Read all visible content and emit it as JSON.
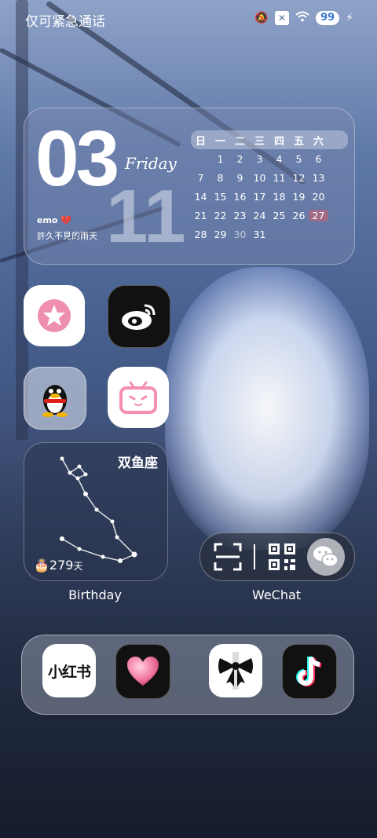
{
  "status_bar": {
    "carrier": "仅可紧急通话",
    "battery": "99",
    "icons": [
      "mute-icon",
      "no-sim-icon",
      "wifi-icon",
      "battery-icon",
      "charging-icon"
    ]
  },
  "date_widget": {
    "day": "03",
    "weekday": "Friday",
    "month": "11",
    "mood": "emo 💔",
    "phrase": "許久不見的雨天",
    "calendar": {
      "headers": [
        "日",
        "一",
        "二",
        "三",
        "四",
        "五",
        "六"
      ],
      "weeks": [
        [
          "",
          "1",
          "2",
          "3",
          "4",
          "5",
          "6"
        ],
        [
          "7",
          "8",
          "9",
          "10",
          "11",
          "12",
          "13"
        ],
        [
          "14",
          "15",
          "16",
          "17",
          "18",
          "19",
          "20"
        ],
        [
          "21",
          "22",
          "23",
          "24",
          "25",
          "26",
          "27"
        ],
        [
          "28",
          "29",
          "30",
          "31",
          "",
          "",
          ""
        ]
      ],
      "today": "27",
      "dimmed": [
        "30"
      ]
    }
  },
  "apps": {
    "row1": [
      {
        "name": "star-app",
        "icon": "pink-star-icon"
      },
      {
        "name": "weibo",
        "icon": "weibo-icon"
      }
    ],
    "row2": [
      {
        "name": "qq",
        "icon": "qq-penguin-icon"
      },
      {
        "name": "bilibili",
        "icon": "bilibili-tv-icon"
      }
    ]
  },
  "constellation_widget": {
    "sign": "双鱼座",
    "days": "279",
    "unit": "天",
    "label": "Birthday"
  },
  "wechat_widget": {
    "label": "WeChat",
    "icons": [
      "scan-icon",
      "qr-code-icon",
      "wechat-icon"
    ]
  },
  "dock": {
    "apps": [
      {
        "name": "xiaohongshu",
        "text": "小红书"
      },
      {
        "name": "heart-app",
        "icon": "heart-icon"
      },
      {
        "name": "bow-app",
        "icon": "bow-icon"
      },
      {
        "name": "tiktok",
        "icon": "tiktok-note-icon"
      }
    ]
  },
  "colors": {
    "today_highlight": "#a06a86",
    "battery_text": "#3a7bd5",
    "xhs_text": "#111111",
    "bili_pink": "#f58fb2"
  }
}
